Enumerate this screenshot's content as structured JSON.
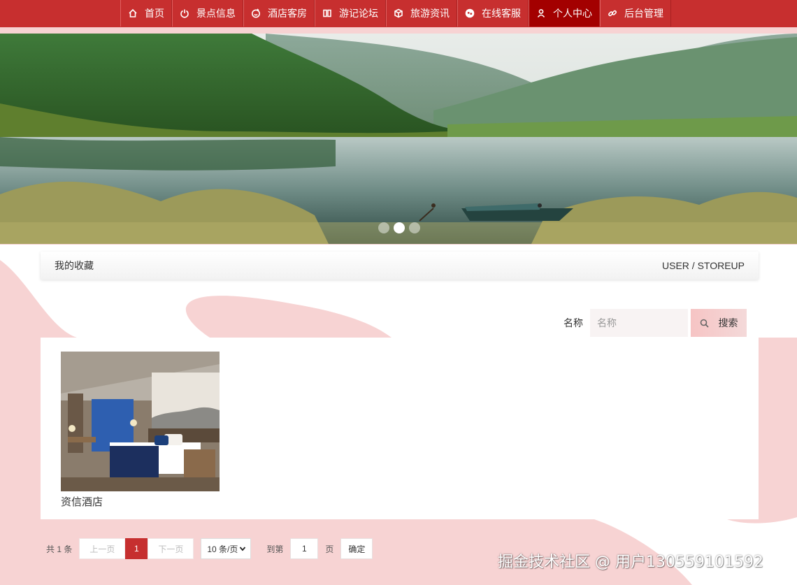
{
  "nav": {
    "items": [
      {
        "label": "首页",
        "icon": "home-icon"
      },
      {
        "label": "景点信息",
        "icon": "power-icon"
      },
      {
        "label": "酒店客房",
        "icon": "smile-icon"
      },
      {
        "label": "游记论坛",
        "icon": "columns-icon"
      },
      {
        "label": "旅游资讯",
        "icon": "cube-icon"
      },
      {
        "label": "在线客服",
        "icon": "chat-icon"
      },
      {
        "label": "个人中心",
        "icon": "user-icon"
      },
      {
        "label": "后台管理",
        "icon": "link-icon"
      }
    ],
    "active_index": 6,
    "bg_color": "#c72f2f",
    "active_color": "#a30000"
  },
  "banner": {
    "slide_count": 3,
    "active_slide": 2
  },
  "breadcrumb": {
    "title": "我的收藏",
    "path": "USER / STOREUP"
  },
  "search": {
    "label": "名称",
    "placeholder": "名称",
    "button_label": "搜索"
  },
  "items": [
    {
      "title": "资信酒店"
    }
  ],
  "pagination": {
    "total_text": "共 1 条",
    "prev_label": "上一页",
    "current_page": "1",
    "next_label": "下一页",
    "page_size": "10 条/页",
    "goto_label": "到第",
    "goto_value": "1",
    "page_unit": "页",
    "confirm_label": "确定"
  },
  "watermark": "掘金技术社区 @ 用户130559101592",
  "colors": {
    "page_bg": "#f7d3d3",
    "accent": "#c62f2f"
  }
}
